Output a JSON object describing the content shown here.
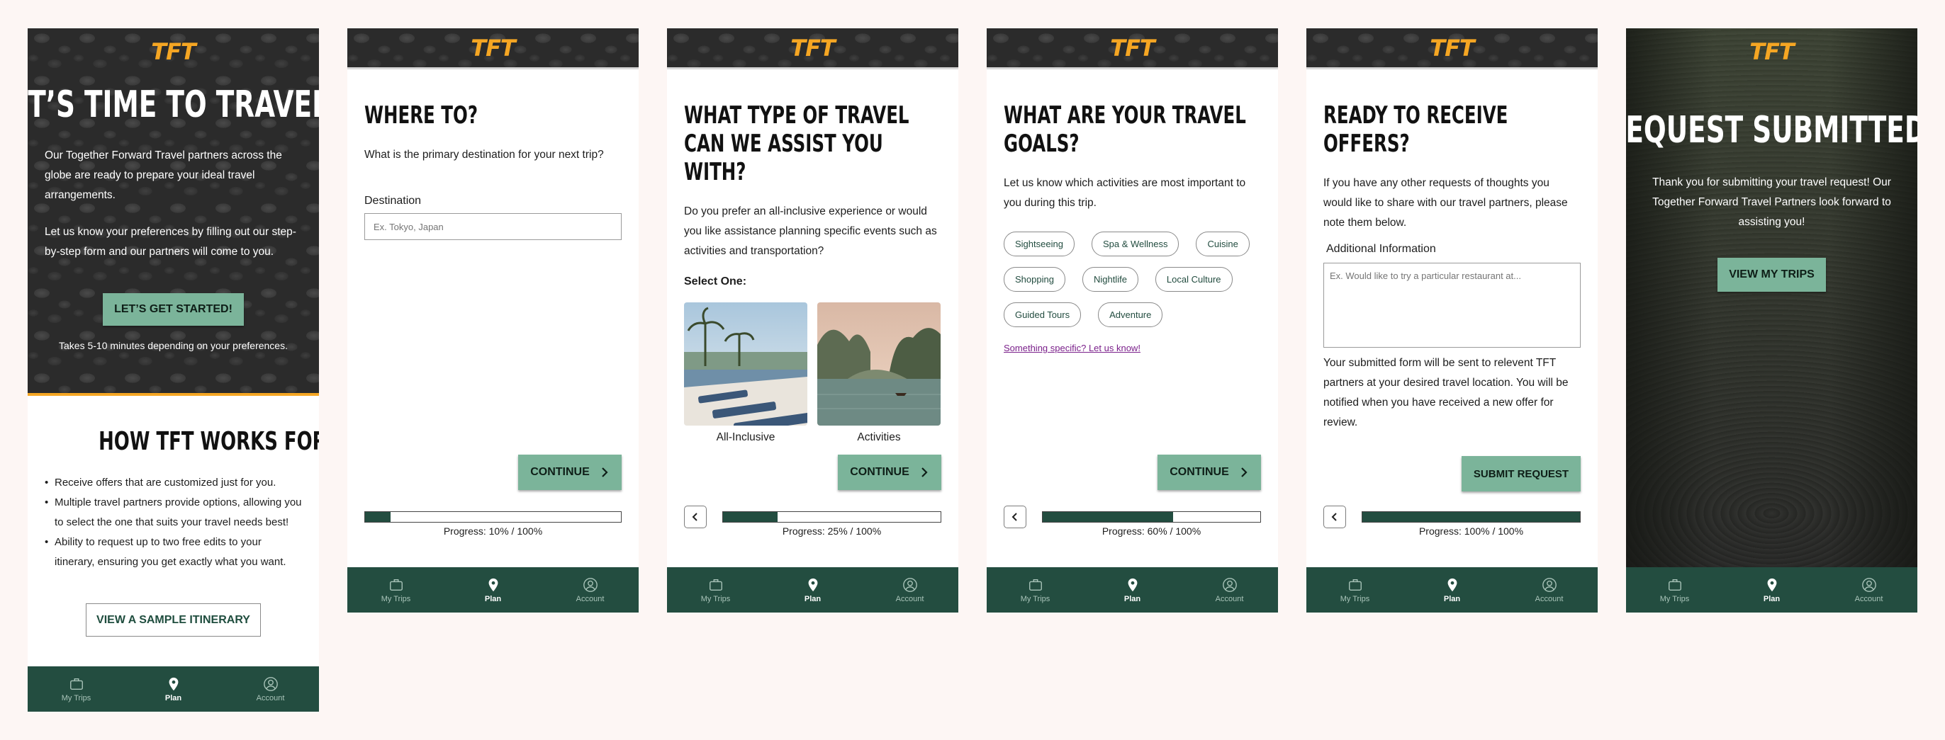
{
  "brand": {
    "logo_text": "TFT",
    "accent": "#f5a623",
    "green": "#234d40",
    "button_green": "#7bb49a"
  },
  "nav": {
    "my_trips": "My Trips",
    "plan": "Plan",
    "account": "Account",
    "active": "Plan"
  },
  "screen1": {
    "hero_title": "IT’S TIME TO TRAVEL",
    "hero_p1": "Our Together Forward Travel partners across the globe are ready to prepare your ideal travel arrangements.",
    "hero_p2": "Let us know your preferences by filling out our step-by-step form and our partners will come to you.",
    "cta": "LET’S GET STARTED!",
    "note": "Takes 5-10 minutes depending on your preferences.",
    "how_title": "HOW TFT WORKS FOR YOU",
    "bullets": [
      "Receive offers that are customized just for you.",
      "Multiple travel partners provide options, allowing you to select the one that suits your travel needs best!",
      "Ability to request up to two free edits to your itinerary, ensuring you get exactly what you want."
    ],
    "sample_button": "VIEW A SAMPLE ITINERARY"
  },
  "screen2": {
    "title": "WHERE TO?",
    "description": "What is the primary destination for your next trip?",
    "field_label": "Destination",
    "placeholder": "Ex. Tokyo, Japan",
    "continue": "CONTINUE",
    "progress": 10,
    "progress_label": "Progress: 10% / 100%"
  },
  "screen3": {
    "title": "WHAT TYPE OF TRAVEL CAN WE ASSIST YOU WITH?",
    "description": "Do you prefer an all-inclusive experience or would you like assistance planning specific events such as activities and transportation?",
    "select_label": "Select One:",
    "options": [
      "All-Inclusive",
      "Activities"
    ],
    "continue": "CONTINUE",
    "progress": 25,
    "progress_label": "Progress: 25% / 100%"
  },
  "screen4": {
    "title": "WHAT ARE YOUR TRAVEL GOALS?",
    "description": "Let us know which activities are most important to you during this trip.",
    "chips": [
      "Sightseeing",
      "Spa & Wellness",
      "Cuisine",
      "Shopping",
      "Nightlife",
      "Local Culture",
      "Guided Tours",
      "Adventure"
    ],
    "link": "Something specific? Let us know!",
    "continue": "CONTINUE",
    "progress": 60,
    "progress_label": "Progress: 60% / 100%"
  },
  "screen5": {
    "title": "READY TO RECEIVE OFFERS?",
    "description": "If you have any other requests of thoughts you would like to share with our travel partners, please note them below.",
    "field_label": "Additional Information",
    "placeholder": "Ex. Would like to try a particular restaurant at...",
    "note": "Your submitted form will be sent to relevent TFT partners at your desired travel location. You will be notified when you have received a new offer for review.",
    "submit": "SUBMIT REQUEST",
    "progress": 100,
    "progress_label": "Progress: 100% / 100%"
  },
  "screen6": {
    "title": "REQUEST SUBMITTED!",
    "message": "Thank you for submitting your travel request! Our Together Forward Travel Partners look forward to assisting you!",
    "button": "VIEW MY TRIPS"
  }
}
